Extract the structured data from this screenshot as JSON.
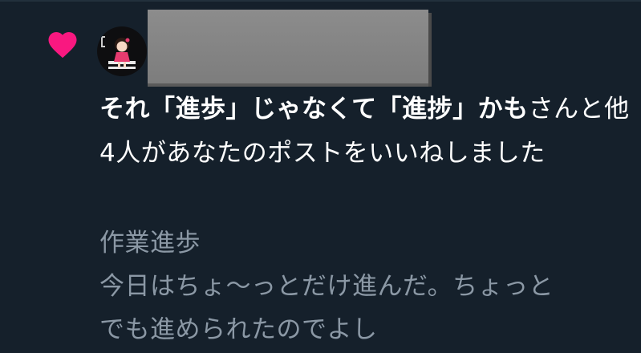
{
  "notification": {
    "actor_name": "それ「進歩」じゃなくて「進捗」かも",
    "action_text": "さんと他4人があなたのポストをいいねしました"
  },
  "post": {
    "title": "作業進歩",
    "body_line1": "今日はちょ〜っとだけ進んだ。ちょっと",
    "body_line2": "でも進められたのでよし"
  },
  "colors": {
    "background": "#15202b",
    "heart": "#f91880",
    "text_primary": "#ffffff",
    "text_secondary": "#8b98a5",
    "redaction": "#858585"
  },
  "icons": {
    "like": "heart-icon"
  }
}
